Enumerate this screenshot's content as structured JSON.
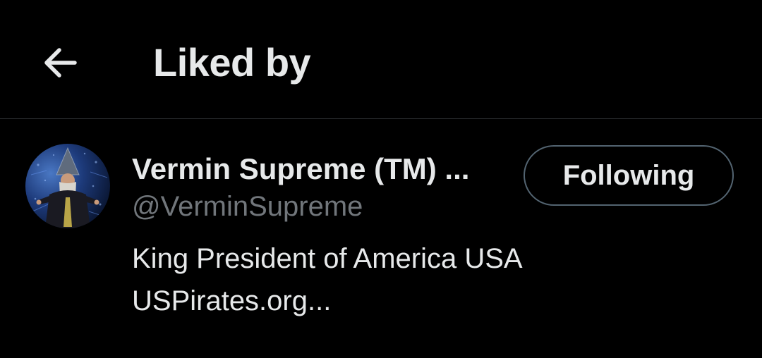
{
  "header": {
    "back_icon": "arrow-left-icon",
    "title": "Liked by"
  },
  "users": [
    {
      "display_name": "Vermin Supreme (TM) ...",
      "handle": "@VerminSupreme",
      "follow_label": "Following",
      "bio_lines": [
        "King President of America USA",
        "USPirates.org..."
      ]
    }
  ],
  "colors": {
    "background": "#000000",
    "primary_text": "#e7e9ea",
    "secondary_text": "#71767b",
    "divider": "#2f3336",
    "button_border": "#536471"
  }
}
